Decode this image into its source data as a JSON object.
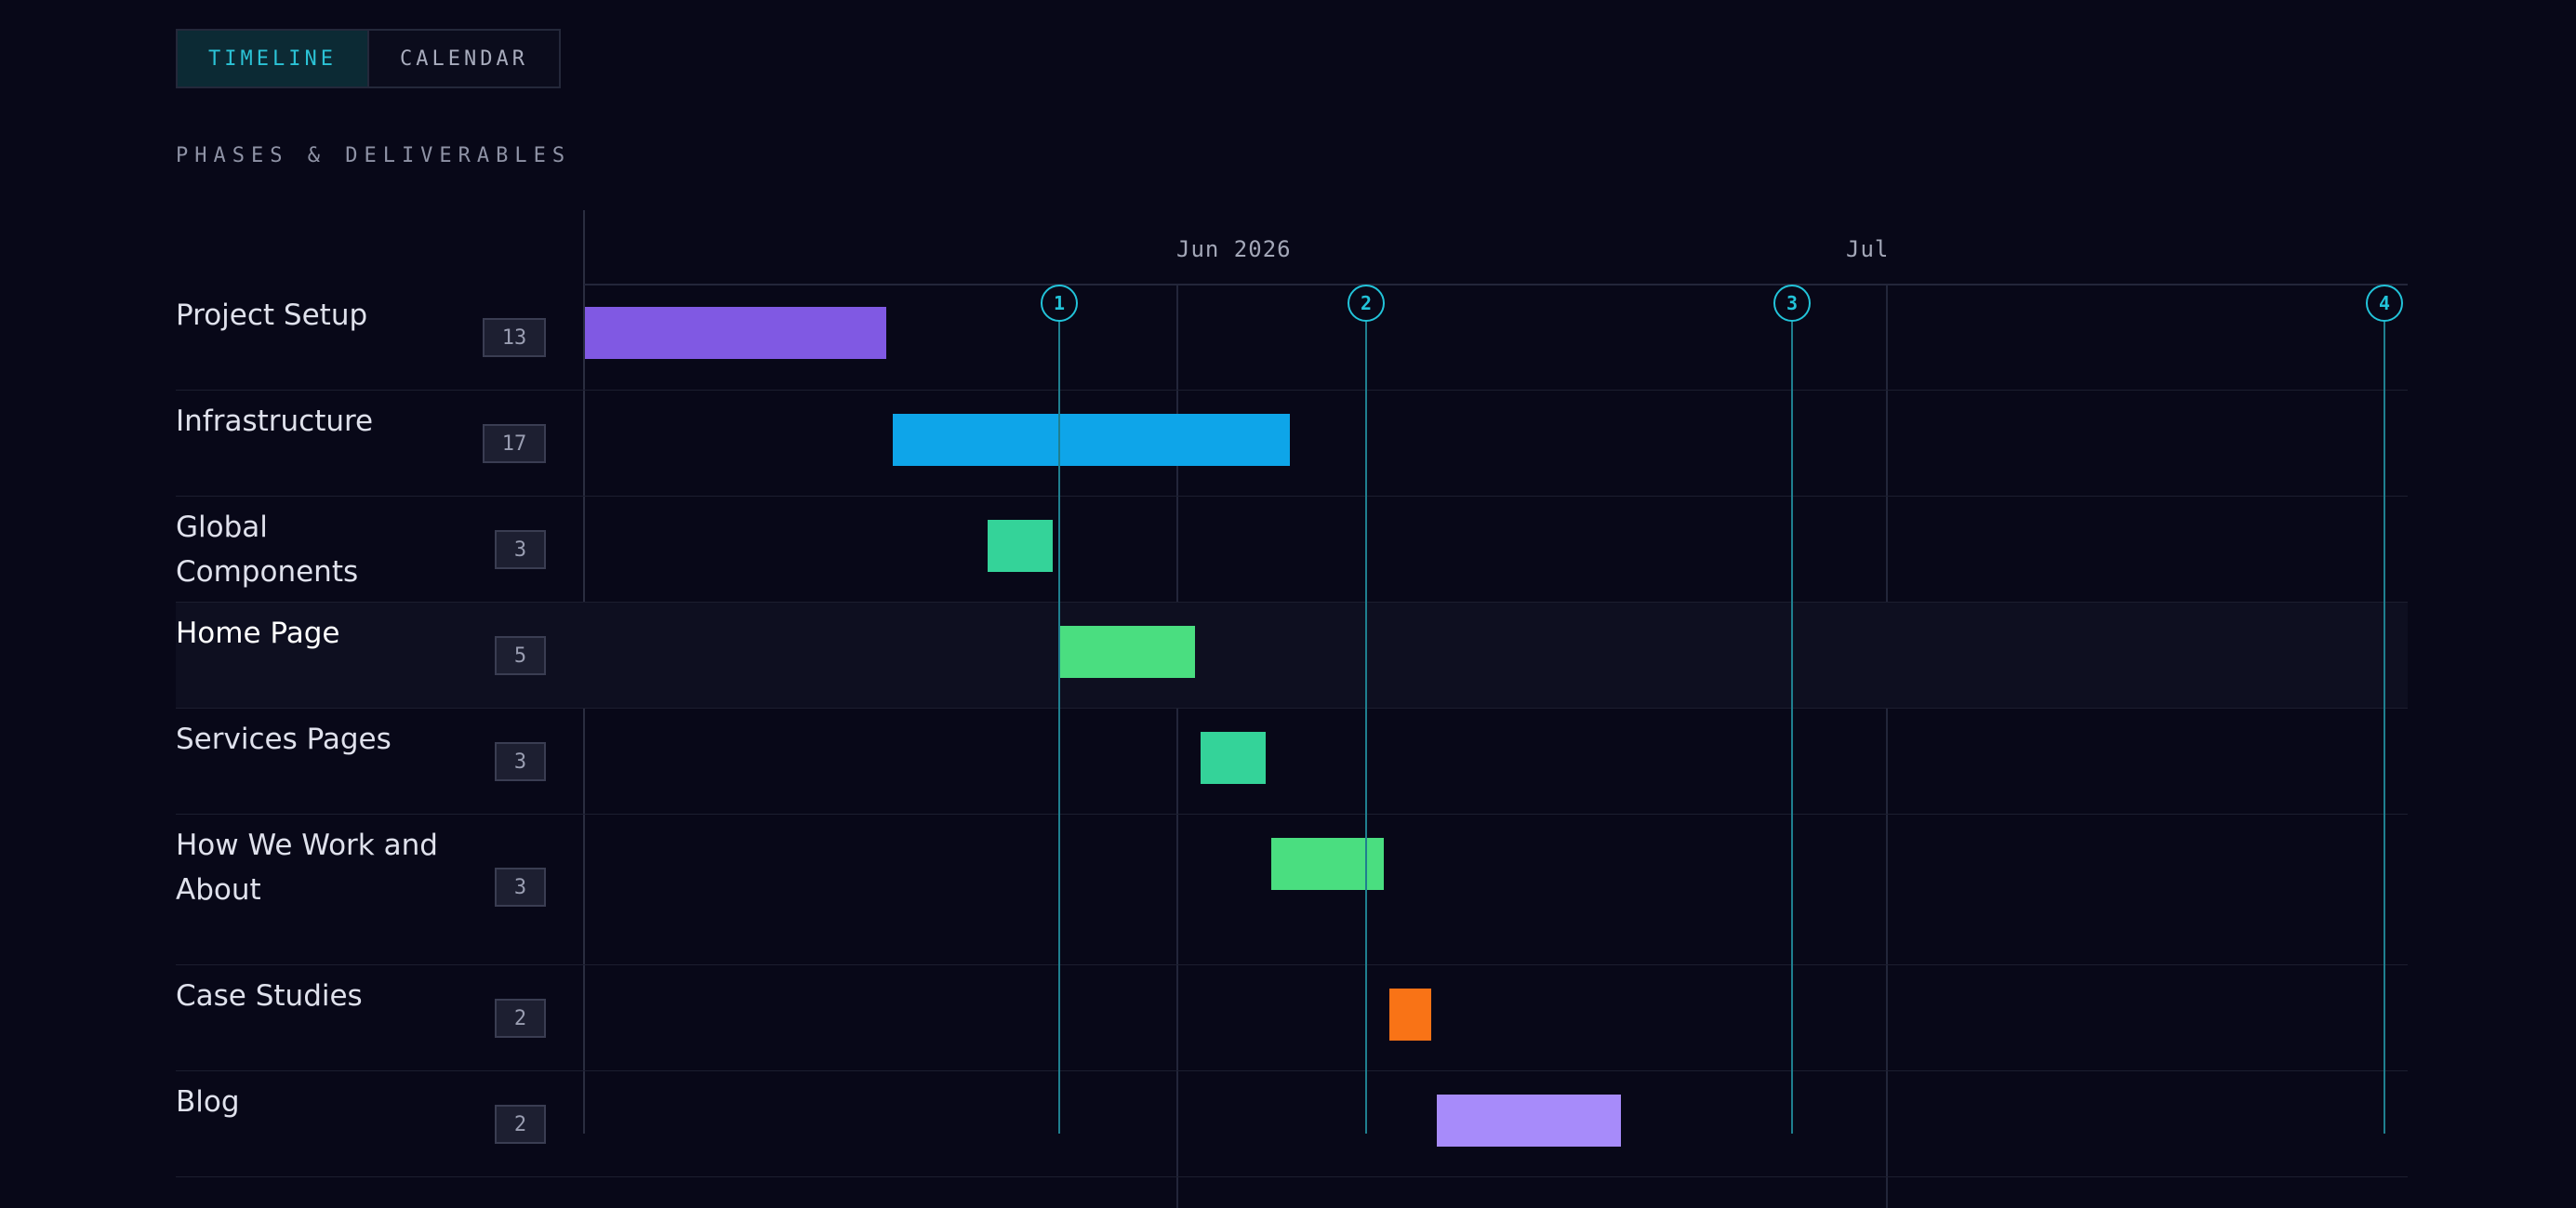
{
  "tabs": {
    "timeline": "TIMELINE",
    "calendar": "CALENDAR",
    "active": "timeline"
  },
  "section_title": "PHASES & DELIVERABLES",
  "months": [
    {
      "label": "Jun 2026"
    },
    {
      "label": "Jul"
    }
  ],
  "milestones": [
    {
      "label": "1"
    },
    {
      "label": "2"
    },
    {
      "label": "3"
    },
    {
      "label": "4"
    }
  ],
  "phases": [
    {
      "name": "Project Setup",
      "count": "13",
      "color": "#8059e3"
    },
    {
      "name": "Infrastructure",
      "count": "17",
      "color": "#0ea5e9"
    },
    {
      "name": "Global Components",
      "count": "3",
      "color": "#34d399"
    },
    {
      "name": "Home Page",
      "count": "5",
      "color": "#4ade80",
      "highlighted": true
    },
    {
      "name": "Services Pages",
      "count": "3",
      "color": "#34d399"
    },
    {
      "name": "How We Work and About",
      "count": "3",
      "color": "#4ade80"
    },
    {
      "name": "Case Studies",
      "count": "2",
      "color": "#f97316"
    },
    {
      "name": "Blog",
      "count": "2",
      "color": "#a78bfa"
    }
  ]
}
